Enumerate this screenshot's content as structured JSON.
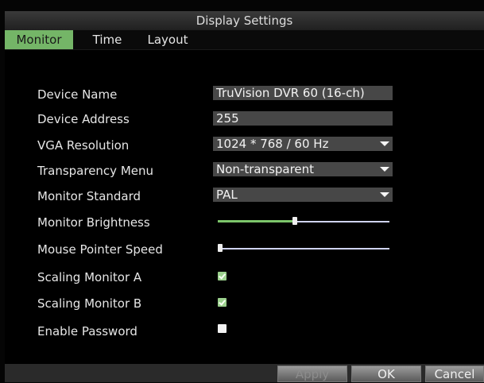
{
  "window": {
    "title": "Display Settings"
  },
  "tabs": [
    {
      "label": "Monitor",
      "active": true
    },
    {
      "label": "Time",
      "active": false
    },
    {
      "label": "Layout",
      "active": false
    }
  ],
  "fields": {
    "device_name": {
      "label": "Device Name",
      "value": "TruVision DVR 60 (16-ch)"
    },
    "device_address": {
      "label": "Device Address",
      "value": "255"
    },
    "vga_resolution": {
      "label": "VGA Resolution",
      "value": "1024 * 768 / 60 Hz"
    },
    "transparency_menu": {
      "label": "Transparency Menu",
      "value": "Non-transparent"
    },
    "monitor_standard": {
      "label": "Monitor Standard",
      "value": "PAL"
    },
    "monitor_brightness": {
      "label": "Monitor Brightness",
      "level": 0.45
    },
    "mouse_pointer_speed": {
      "label": "Mouse Pointer Speed",
      "level": 0.0
    },
    "scaling_monitor_a": {
      "label": "Scaling Monitor A",
      "checked": true
    },
    "scaling_monitor_b": {
      "label": "Scaling Monitor B",
      "checked": true
    },
    "enable_password": {
      "label": "Enable Password",
      "checked": false
    }
  },
  "buttons": {
    "apply": "Apply",
    "ok": "OK",
    "cancel": "Cancel"
  },
  "colors": {
    "accent": "#74b567",
    "field_bg": "#474747"
  }
}
